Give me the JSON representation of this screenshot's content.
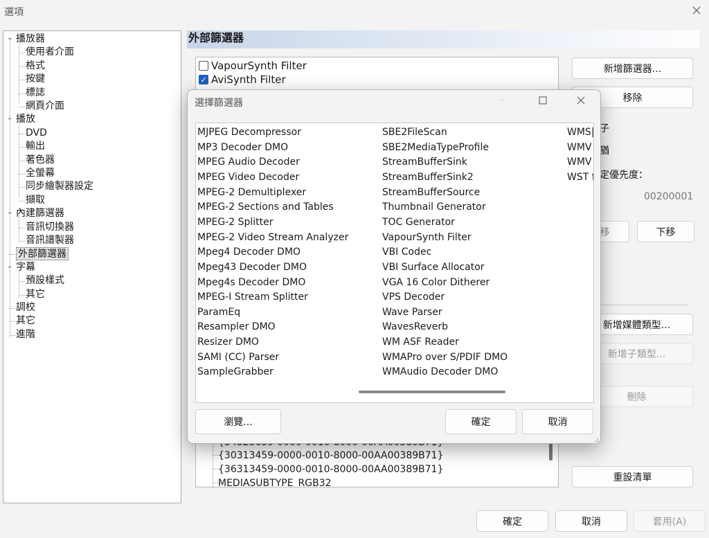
{
  "window": {
    "title": "選項"
  },
  "tree": {
    "items": [
      {
        "label": "播放器",
        "level": 0,
        "expanded": true
      },
      {
        "label": "使用者介面",
        "level": 1
      },
      {
        "label": "格式",
        "level": 1
      },
      {
        "label": "按鍵",
        "level": 1
      },
      {
        "label": "標誌",
        "level": 1
      },
      {
        "label": "網頁介面",
        "level": 1
      },
      {
        "label": "播放",
        "level": 0,
        "expanded": true
      },
      {
        "label": "DVD",
        "level": 1
      },
      {
        "label": "輸出",
        "level": 1
      },
      {
        "label": "著色器",
        "level": 1
      },
      {
        "label": "全螢幕",
        "level": 1
      },
      {
        "label": "同步繪製器設定",
        "level": 1
      },
      {
        "label": "擷取",
        "level": 1
      },
      {
        "label": "內建篩選器",
        "level": 0,
        "expanded": true
      },
      {
        "label": "音訊切換器",
        "level": 1
      },
      {
        "label": "音訊譜製器",
        "level": 1
      },
      {
        "label": "外部篩選器",
        "level": 0,
        "selected": true
      },
      {
        "label": "字幕",
        "level": 0,
        "expanded": true
      },
      {
        "label": "預設樣式",
        "level": 1
      },
      {
        "label": "其它",
        "level": 1
      },
      {
        "label": "調校",
        "level": 0
      },
      {
        "label": "其它",
        "level": 0
      },
      {
        "label": "進階",
        "level": 0
      }
    ]
  },
  "section": {
    "title": "外部篩選器"
  },
  "filters": [
    {
      "label": "VapourSynth Filter",
      "checked": false
    },
    {
      "label": "AviSynth Filter",
      "checked": true
    }
  ],
  "right": {
    "add_filter": "新增篩選器...",
    "remove": "移除",
    "frag1": "子",
    "frag2": "猶",
    "priority_label": "定優先度：",
    "merit_value": "00200001",
    "move_up": "移",
    "move_down": "下移",
    "add_media_type": "新增媒體類型...",
    "add_subtype": "新增子類型...",
    "delete": "刪除",
    "reset_list": "重設清單"
  },
  "lower_list": [
    "{34323659-0000-0010-8000-00AA00389B71}",
    "{30313459-0000-0010-8000-00AA00389B71}",
    "{36313459-0000-0010-8000-00AA00389B71}",
    "MEDIASUBTYPE_RGB32"
  ],
  "footer": {
    "ok": "確定",
    "cancel": "取消",
    "apply": "套用(A)"
  },
  "modal": {
    "title": "選擇篩選器",
    "col1": [
      "MJPEG Decompressor",
      "MP3 Decoder DMO",
      "MPEG Audio Decoder",
      "MPEG Video Decoder",
      "MPEG-2 Demultiplexer",
      "MPEG-2 Sections and Tables",
      "MPEG-2 Splitter",
      "MPEG-2 Video Stream Analyzer",
      "Mpeg4 Decoder DMO",
      "Mpeg43 Decoder DMO",
      "Mpeg4s Decoder DMO",
      "MPEG-I Stream Splitter",
      "ParamEq",
      "Resampler DMO",
      "Resizer DMO",
      "SAMI (CC) Parser",
      "SampleGrabber"
    ],
    "col2": [
      "SBE2FileScan",
      "SBE2MediaTypeProfile",
      "StreamBufferSink",
      "StreamBufferSink2",
      "StreamBufferSource",
      "Thumbnail Generator",
      "TOC Generator",
      "VapourSynth Filter",
      "VBI Codec",
      "VBI Surface Allocator",
      "VGA 16 Color Ditherer",
      "VPS Decoder",
      "Wave Parser",
      "WavesReverb",
      "WM ASF Reader",
      "WMAPro over S/PDIF DMO",
      "WMAudio Decoder DMO"
    ],
    "col3": [
      "WMS|",
      "WMV",
      "WMV",
      "WST f"
    ],
    "browse": "瀏覽...",
    "ok": "確定",
    "cancel": "取消"
  }
}
